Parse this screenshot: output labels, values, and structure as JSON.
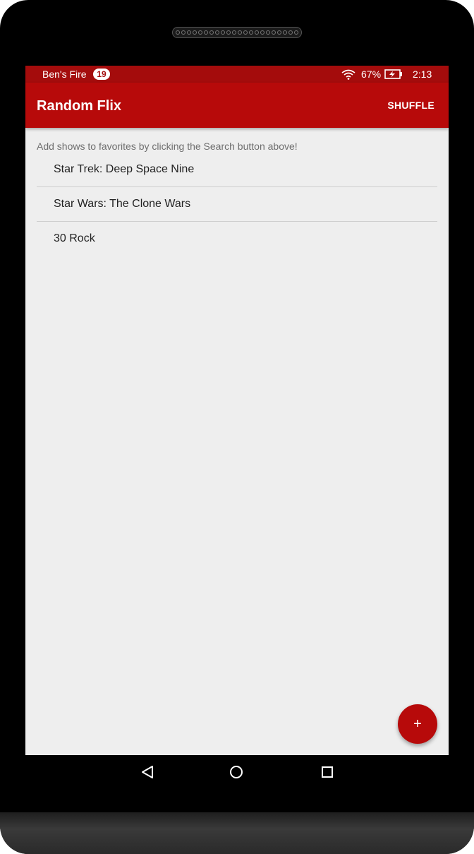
{
  "status_bar": {
    "device_name": "Ben's Fire",
    "notification_count": "19",
    "battery_percent": "67%",
    "time": "2:13",
    "wifi_icon": "wifi-icon",
    "battery_icon": "battery-charging-icon"
  },
  "app_bar": {
    "title": "Random Flix",
    "shuffle_label": "SHUFFLE"
  },
  "main": {
    "hint": "Add shows to favorites by clicking the Search button above!",
    "shows": [
      {
        "title": "Star Trek: Deep Space Nine"
      },
      {
        "title": "Star Wars: The Clone Wars"
      },
      {
        "title": "30 Rock"
      }
    ]
  },
  "fab": {
    "label": "+",
    "icon": "plus-icon"
  },
  "nav_bar": {
    "back_icon": "back-icon",
    "home_icon": "home-icon",
    "recents_icon": "recents-icon"
  },
  "colors": {
    "status_bar": "#a40c0c",
    "app_bar": "#b70a0a",
    "background": "#eeeeee",
    "fab": "#b70a0a"
  }
}
